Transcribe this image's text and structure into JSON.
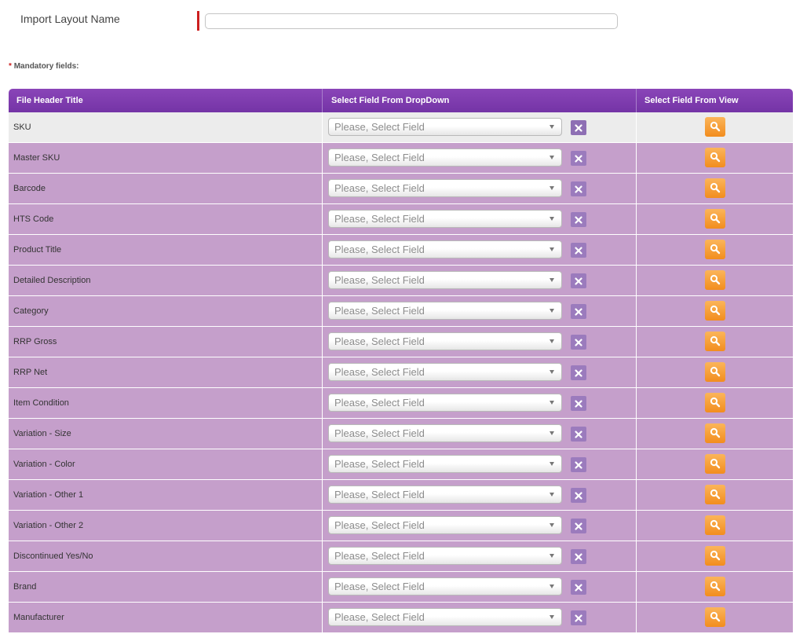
{
  "layout": {
    "label": "Import Layout Name",
    "value": ""
  },
  "mandatory": {
    "star": "*",
    "text": "Mandatory fields:"
  },
  "table": {
    "headers": [
      "File Header Title",
      "Select Field From DropDown",
      "Select Field From View"
    ],
    "select_placeholder": "Please, Select Field",
    "rows": [
      "SKU",
      "Master SKU",
      "Barcode",
      "HTS Code",
      "Product Title",
      "Detailed Description",
      "Category",
      "RRP Gross",
      "RRP Net",
      "Item Condition",
      "Variation - Size",
      "Variation - Color",
      "Variation - Other 1",
      "Variation - Other 2",
      "Discontinued Yes/No",
      "Brand",
      "Manufacturer"
    ]
  },
  "icons": {
    "clear": "close-icon",
    "view": "search-icon",
    "dropdown": "chevron-down-icon"
  },
  "colors": {
    "header_purple": "#7f3db0",
    "row_purple": "#c59fcb",
    "first_row_grey": "#ececec",
    "search_orange": "#f59a2c",
    "clear_purple": "#9b7bbd",
    "required_red": "#cc1f1f"
  }
}
